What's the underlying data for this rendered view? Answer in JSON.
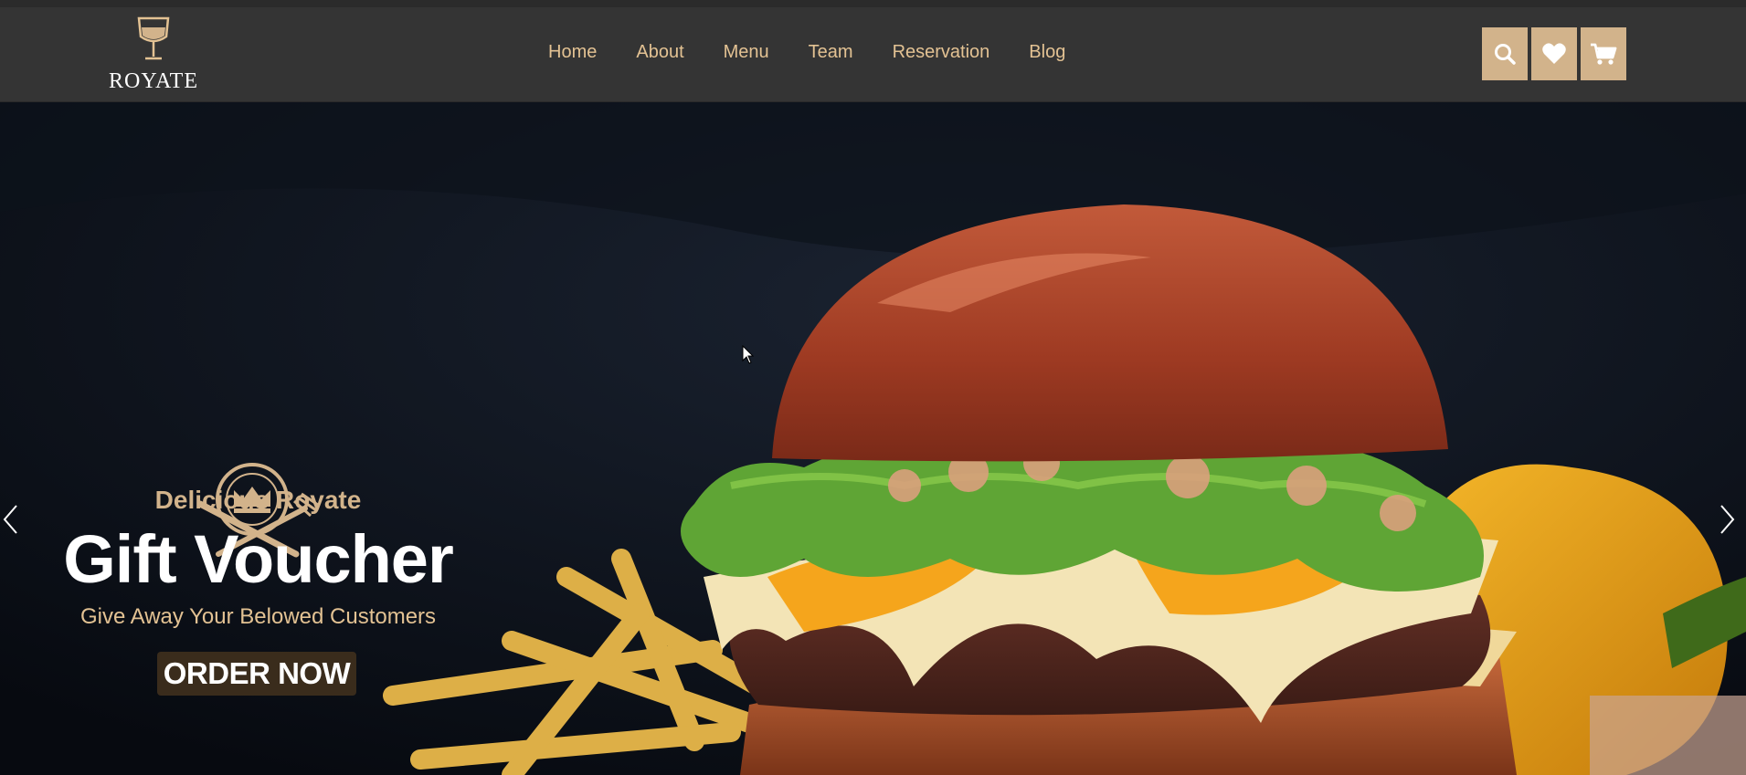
{
  "brand": {
    "name": "ROYATE"
  },
  "nav": {
    "items": [
      {
        "label": "Home"
      },
      {
        "label": "About"
      },
      {
        "label": "Menu"
      },
      {
        "label": "Team"
      },
      {
        "label": "Reservation"
      },
      {
        "label": "Blog"
      }
    ]
  },
  "actions": {
    "icons": [
      "search-icon",
      "heart-icon",
      "cart-icon"
    ]
  },
  "hero": {
    "subtitle": "Delicious Royate",
    "title": "Gift Voucher",
    "description": "Give Away Your Belowed Customers",
    "cta_label": "ORDER NOW",
    "image": "burger-with-fries-and-yellow-pepper"
  },
  "colors": {
    "accent": "#d2b38b",
    "nav_text": "#e3c293",
    "header_bg": "#343434",
    "hero_bg": "#0b0f17"
  }
}
